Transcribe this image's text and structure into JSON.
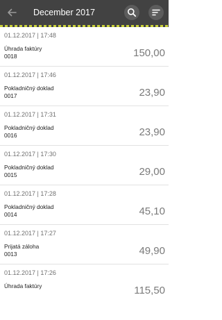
{
  "header": {
    "title": "December 2017",
    "back_icon": "arrow-back-icon",
    "search_icon": "search-icon",
    "sort_icon": "sort-icon",
    "bar_color": "#424242",
    "accent_color": "#c9d13a"
  },
  "transactions": [
    {
      "date": "01.12.2017 | 17:48",
      "type": "Úhrada faktúry",
      "number": "0018",
      "amount": "150,00"
    },
    {
      "date": "01.12.2017 | 17:46",
      "type": "Pokladničný doklad",
      "number": "0017",
      "amount": "23,90"
    },
    {
      "date": "01.12.2017 | 17:31",
      "type": "Pokladničný doklad",
      "number": "0016",
      "amount": "23,90"
    },
    {
      "date": "01.12.2017 | 17:30",
      "type": "Pokladničný doklad",
      "number": "0015",
      "amount": "29,00"
    },
    {
      "date": "01.12.2017 | 17:28",
      "type": "Pokladničný doklad",
      "number": "0014",
      "amount": "45,10"
    },
    {
      "date": "01.12.2017 | 17:27",
      "type": "Prijatá záloha",
      "number": "0013",
      "amount": "49,90"
    },
    {
      "date": "01.12.2017 | 17:26",
      "type": "Úhrada faktúry",
      "number": "",
      "amount": "115,50"
    }
  ]
}
